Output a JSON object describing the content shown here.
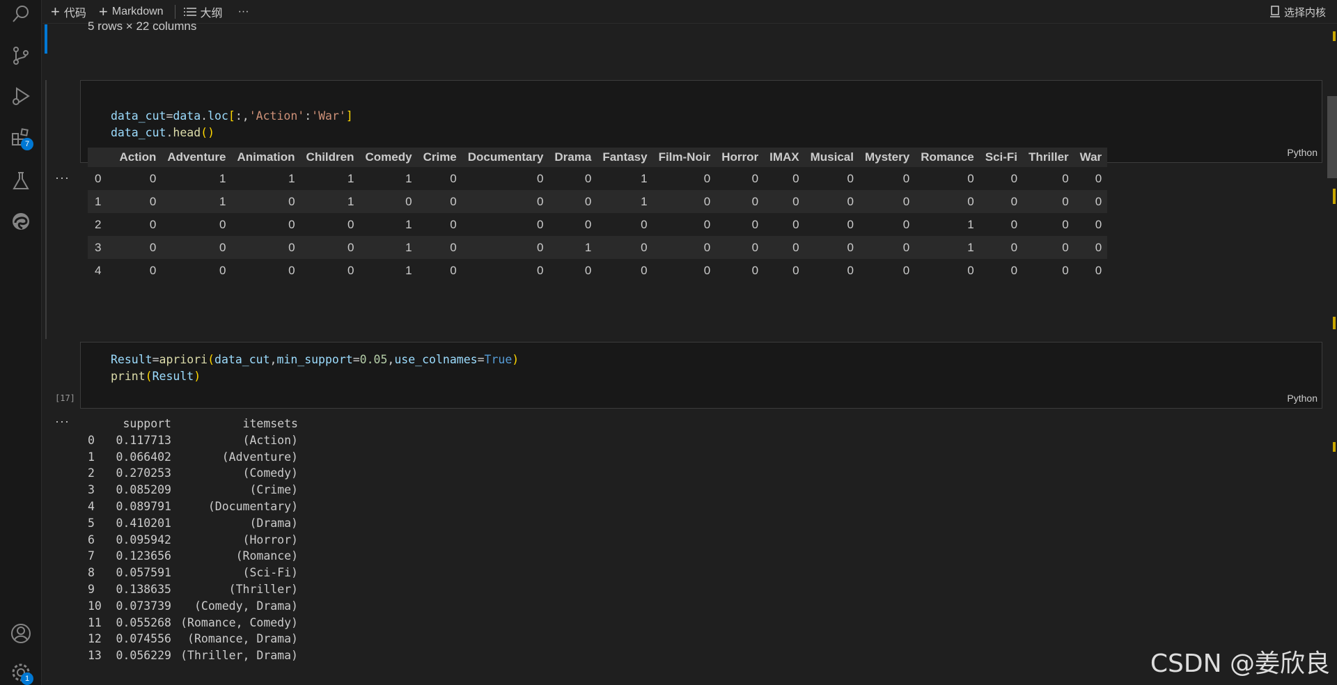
{
  "toolbar": {
    "code_label": "代码",
    "markdown_label": "Markdown",
    "outline_label": "大纲",
    "more": "···",
    "kernel_label": "选择内核"
  },
  "activitybar": {
    "icons": [
      "search-icon",
      "source-control-icon",
      "run-debug-icon",
      "extensions-icon",
      "testing-icon",
      "edge-icon",
      "account-icon",
      "settings-icon"
    ],
    "extensions_badge": "7",
    "settings_badge": "1"
  },
  "prev_output": {
    "rows_cols": "5 rows × 22 columns"
  },
  "cell1": {
    "lang": "Python",
    "output_dots": "···"
  },
  "dataframe": {
    "columns": [
      "Action",
      "Adventure",
      "Animation",
      "Children",
      "Comedy",
      "Crime",
      "Documentary",
      "Drama",
      "Fantasy",
      "Film-Noir",
      "Horror",
      "IMAX",
      "Musical",
      "Mystery",
      "Romance",
      "Sci-Fi",
      "Thriller",
      "War"
    ],
    "rows": [
      {
        "index": "0",
        "values": [
          "0",
          "1",
          "1",
          "1",
          "1",
          "0",
          "0",
          "0",
          "1",
          "0",
          "0",
          "0",
          "0",
          "0",
          "0",
          "0",
          "0",
          "0"
        ]
      },
      {
        "index": "1",
        "values": [
          "0",
          "1",
          "0",
          "1",
          "0",
          "0",
          "0",
          "0",
          "1",
          "0",
          "0",
          "0",
          "0",
          "0",
          "0",
          "0",
          "0",
          "0"
        ]
      },
      {
        "index": "2",
        "values": [
          "0",
          "0",
          "0",
          "0",
          "1",
          "0",
          "0",
          "0",
          "0",
          "0",
          "0",
          "0",
          "0",
          "0",
          "1",
          "0",
          "0",
          "0"
        ]
      },
      {
        "index": "3",
        "values": [
          "0",
          "0",
          "0",
          "0",
          "1",
          "0",
          "0",
          "1",
          "0",
          "0",
          "0",
          "0",
          "0",
          "0",
          "1",
          "0",
          "0",
          "0"
        ]
      },
      {
        "index": "4",
        "values": [
          "0",
          "0",
          "0",
          "0",
          "1",
          "0",
          "0",
          "0",
          "0",
          "0",
          "0",
          "0",
          "0",
          "0",
          "0",
          "0",
          "0",
          "0"
        ]
      }
    ]
  },
  "cell2": {
    "exec_count": "[17]",
    "lang": "Python",
    "output_dots": "···"
  },
  "result": {
    "header_support": "support",
    "header_itemsets": "itemsets",
    "rows": [
      {
        "i": "0",
        "support": "0.117713",
        "itemsets": "(Action)"
      },
      {
        "i": "1",
        "support": "0.066402",
        "itemsets": "(Adventure)"
      },
      {
        "i": "2",
        "support": "0.270253",
        "itemsets": "(Comedy)"
      },
      {
        "i": "3",
        "support": "0.085209",
        "itemsets": "(Crime)"
      },
      {
        "i": "4",
        "support": "0.089791",
        "itemsets": "(Documentary)"
      },
      {
        "i": "5",
        "support": "0.410201",
        "itemsets": "(Drama)"
      },
      {
        "i": "6",
        "support": "0.095942",
        "itemsets": "(Horror)"
      },
      {
        "i": "7",
        "support": "0.123656",
        "itemsets": "(Romance)"
      },
      {
        "i": "8",
        "support": "0.057591",
        "itemsets": "(Sci-Fi)"
      },
      {
        "i": "9",
        "support": "0.138635",
        "itemsets": "(Thriller)"
      },
      {
        "i": "10",
        "support": "0.073739",
        "itemsets": "(Comedy, Drama)"
      },
      {
        "i": "11",
        "support": "0.055268",
        "itemsets": "(Romance, Comedy)"
      },
      {
        "i": "12",
        "support": "0.074556",
        "itemsets": "(Romance, Drama)"
      },
      {
        "i": "13",
        "support": "0.056229",
        "itemsets": "(Thriller, Drama)"
      }
    ]
  },
  "watermark": "CSDN @姜欣良"
}
